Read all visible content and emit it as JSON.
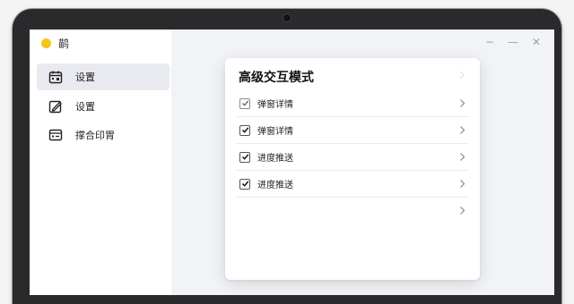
{
  "app": {
    "name": "鹋",
    "logo_color": "#f5c518"
  },
  "sidebar": {
    "items": [
      {
        "label": "设置",
        "icon": "calendar-icon",
        "active": true
      },
      {
        "label": "设置",
        "icon": "edit-icon",
        "active": false
      },
      {
        "label": "撑合印胃",
        "icon": "list-card-icon",
        "active": false
      }
    ]
  },
  "window_controls": {
    "minimize": "−",
    "maximize": "—",
    "close": "✕"
  },
  "panel": {
    "title": "高级交互模式",
    "rows": [
      {
        "label": "弹窗详情",
        "checked": true,
        "style": "light"
      },
      {
        "label": "弹窗详情",
        "checked": true,
        "style": "dark"
      },
      {
        "label": "进度推送",
        "checked": true,
        "style": "dark"
      },
      {
        "label": "进度推送",
        "checked": true,
        "style": "dark"
      },
      {
        "label": "",
        "checked": false,
        "style": "none"
      }
    ]
  }
}
